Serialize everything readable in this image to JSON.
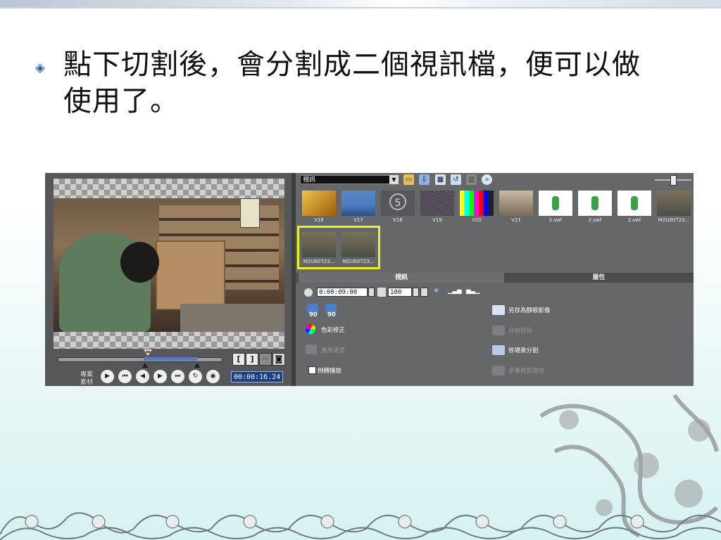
{
  "slide": {
    "bullet_text": "點下切割後，會分割成二個視訊檔，便可以做使用了。"
  },
  "player": {
    "mode_project": "專案",
    "mode_clip": "素材",
    "timecode": "00:00:16.24",
    "mark_in": "[",
    "mark_out": "]"
  },
  "library": {
    "dropdown": "視訊",
    "thumbnails": [
      {
        "label": "V16",
        "color": "#d7a12a"
      },
      {
        "label": "V17",
        "color": "#3b6fb8"
      },
      {
        "label": "V18",
        "color": "#55575a"
      },
      {
        "label": "V19",
        "color": "#4a4550"
      },
      {
        "label": "V20",
        "color": "#c8c8c8"
      },
      {
        "label": "V21",
        "color": "#9b8975"
      },
      {
        "label": "2.swf",
        "color": "#ffffff"
      },
      {
        "label": "2.swf",
        "color": "#ffffff"
      },
      {
        "label": "2.swf",
        "color": "#ffffff"
      },
      {
        "label": "M2U00723...",
        "color": "#5b6056"
      }
    ],
    "split_clips": [
      {
        "label": "M2U00723...",
        "color": "#5b6056"
      },
      {
        "label": "M2U00723...",
        "color": "#5b6056"
      }
    ]
  },
  "options": {
    "tab_video": "視訊",
    "tab_attributes": "屬性",
    "duration": "0:00:09:00",
    "volume": "100",
    "rotate_left_label": "90",
    "rotate_right_label": "90",
    "color_correction": "色彩修正",
    "playback_speed": "播放速度",
    "reverse_playback": "倒轉播放",
    "save_as_still": "另存為靜態影像",
    "split_audio": "分割音訊",
    "split_by_scene": "依場景分割",
    "multi_trim": "多重修剪視訊"
  }
}
